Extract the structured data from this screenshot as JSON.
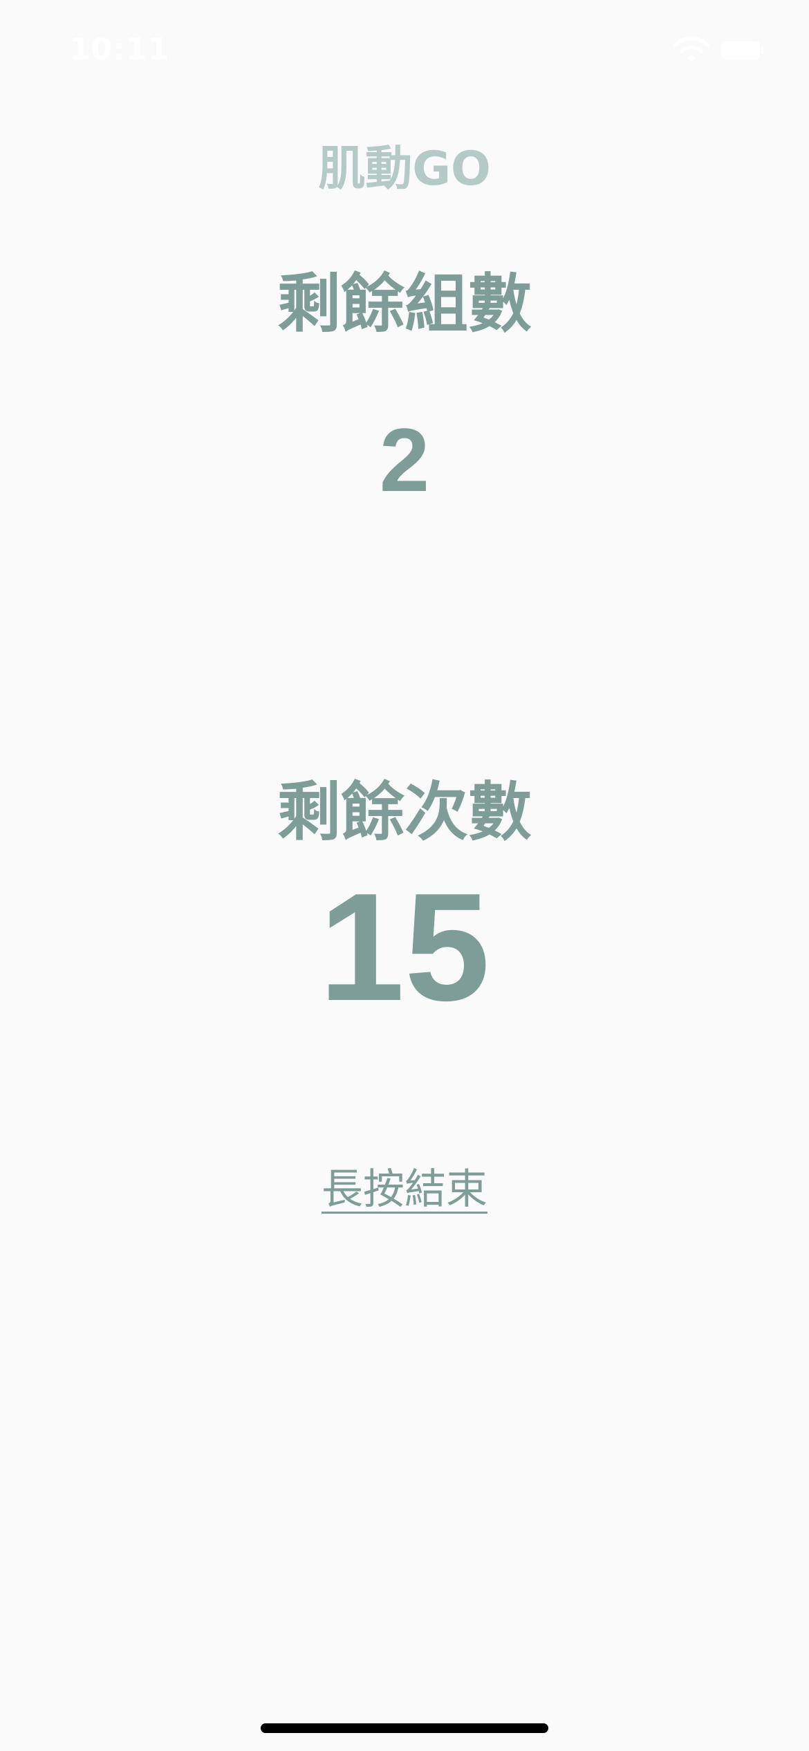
{
  "status_bar": {
    "time": "10:11",
    "icons": [
      "wifi-icon",
      "battery-icon"
    ]
  },
  "app": {
    "title": "肌動GO"
  },
  "sets": {
    "label": "剩餘組數",
    "value": "2"
  },
  "reps": {
    "label": "剩餘次數",
    "value": "15"
  },
  "actions": {
    "end_label": "長按結束"
  },
  "colors": {
    "background": "#fafafa",
    "accent": "#7e9d99",
    "title": "#b4cac7",
    "status_bar_text": "#ffffff",
    "home_indicator": "#000000"
  }
}
